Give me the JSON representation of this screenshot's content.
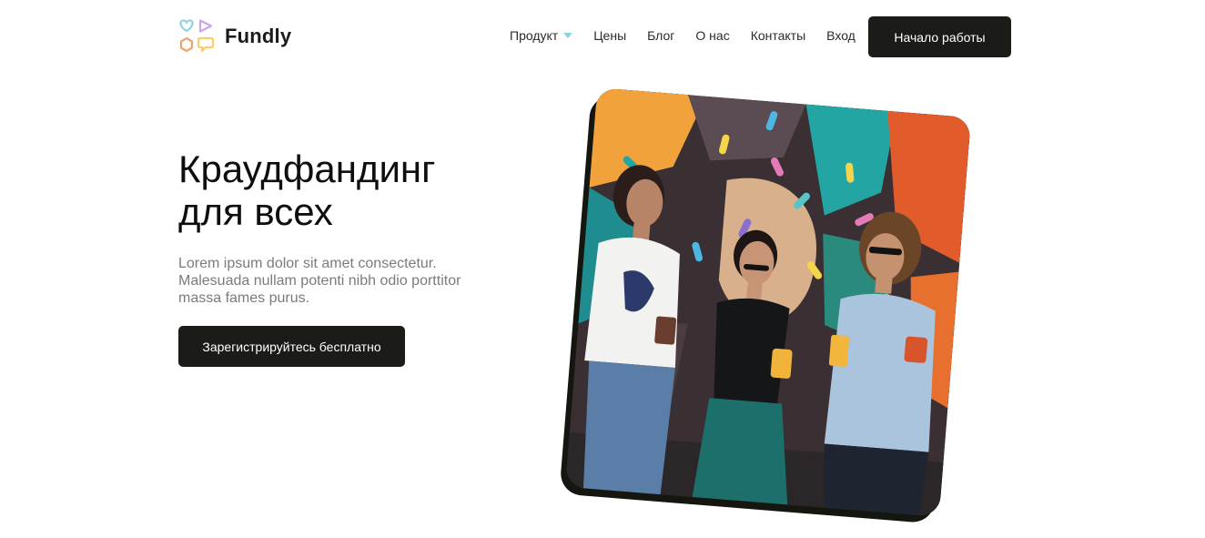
{
  "brand": {
    "name": "Fundly"
  },
  "nav": {
    "items": [
      {
        "label": "Продукт",
        "has_dropdown": true
      },
      {
        "label": "Цены"
      },
      {
        "label": "Блог"
      },
      {
        "label": "О нас"
      },
      {
        "label": "Контакты"
      },
      {
        "label": "Вход"
      }
    ],
    "cta_label": "Начало работы"
  },
  "hero": {
    "title_line1": "Краудфандинг",
    "title_line2": "для всех",
    "subtitle": "Lorem ipsum dolor sit amet consectetur. Malesuada nullam potenti nibh odio porttitor massa fames purus.",
    "cta_label": "Зарегистрируйтесь бесплатно"
  },
  "colors": {
    "primary_button": "#1b1c18",
    "dropdown_caret": "#8fd0e0",
    "subtitle_text": "#7b7b7b",
    "logo_heart": "#8fd3df",
    "logo_play": "#c7a5f0",
    "logo_hex": "#f0a36e",
    "logo_bubble": "#f6cf6a"
  },
  "icons": {
    "logo": "fundly-logo-icon",
    "dropdown": "chevron-down-icon"
  }
}
